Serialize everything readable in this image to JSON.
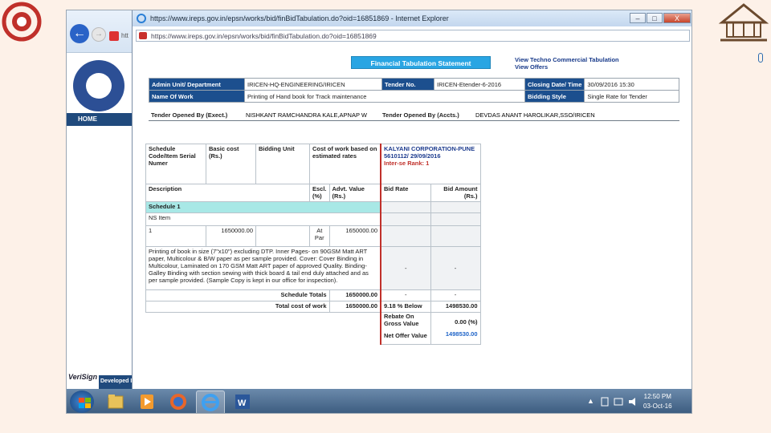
{
  "window": {
    "title": "https://www.ireps.gov.in/epsn/works/bid/finBidTabulation.do?oid=16851869 - Internet Explorer",
    "address": "https://www.ireps.gov.in/epsn/works/bid/finBidTabulation.do?oid=16851869",
    "minimize": "–",
    "maximize": "□",
    "close": "X"
  },
  "back_browser": {
    "url_fragment": "htt",
    "home": "HOME",
    "verisign": "VeriSign",
    "developed": "Developed I"
  },
  "page": {
    "heading": "Financial Tabulation Statement",
    "link_techno": "View Techno Commercial Tabulation",
    "link_offers": "View Offers"
  },
  "info": {
    "admin_label": "Admin Unit/ Department",
    "admin_value": "IRICEN-HQ-ENGINEERING/IRICEN",
    "tender_label": "Tender No.",
    "tender_value": "IRICEN-Etender-6-2016",
    "closing_label": "Closing Date/ Time",
    "closing_value": "30/09/2016 15:30",
    "work_label": "Name Of Work",
    "work_value": "Printing of Hand book for Track maintenance",
    "style_label": "Bidding Style",
    "style_value": "Single Rate for Tender"
  },
  "opened": {
    "exec_label": "Tender Opened By (Exect.)",
    "exec_value": "NISHKANT RAMCHANDRA KALE,APNAP W",
    "accts_label": "Tender Opened By (Accts.)",
    "accts_value": "DEVDAS ANANT HAROLIKAR,SSO/IRICEN"
  },
  "grid": {
    "h_schedule": "Schedule Code/Item Serial Numer",
    "h_basic": "Basic cost (Rs.)",
    "h_unit": "Bidding Unit",
    "h_cost": "Cost of work based on estimated rates",
    "bidder": "KALYANI CORPORATION-PUNE",
    "bidder_ref": "5610112/ 29/09/2016",
    "inter_rank": "Inter-se Rank: 1",
    "h_desc": "Description",
    "h_escl": "Escl. (%)",
    "h_advt": "Advt. Value (Rs.)",
    "h_bid_rate": "Bid Rate",
    "h_bid_amount": "Bid Amount (Rs.)",
    "schedule": "Schedule 1",
    "ns_item": "NS Item",
    "item_no": "1",
    "item_basic": "1650000.00",
    "item_unit_a": "At",
    "item_unit_b": "Par",
    "item_cost": "1650000.00",
    "item_desc": "Printing of book in size (7\"x10\") excluding DTP. Inner Pages- on 90GSM Matt ART paper, Multicolour & B/W paper as per sample provided. Cover: Cover Binding in Multicolour, Laminated on 170 GSM Matt ART paper of approved Quality. Binding- Galley Binding with section sewing with thick board & tail end duly attached and as per sample provided. (Sample Copy is kept in our office for inspection).",
    "dash": "-",
    "sched_totals_label": "Schedule Totals",
    "sched_totals_value": "1650000.00",
    "total_label": "Total cost of work",
    "total_value": "1650000.00",
    "below": "9.18 % Below",
    "below_amount": "1498530.00",
    "rebate_label": "Rebate On Gross Value",
    "rebate_value": "0.00 (%)",
    "net_label": "Net Offer Value",
    "net_value": "1498530.00"
  },
  "taskbar": {
    "time": "12:50 PM",
    "date": "03-Oct-16",
    "tray": "▲"
  },
  "colors": {
    "header_navy": "#1c4f8e",
    "heading_blue": "#29a5e3",
    "schedule_teal": "#a8e8e6",
    "rank_red": "#c0302a"
  }
}
